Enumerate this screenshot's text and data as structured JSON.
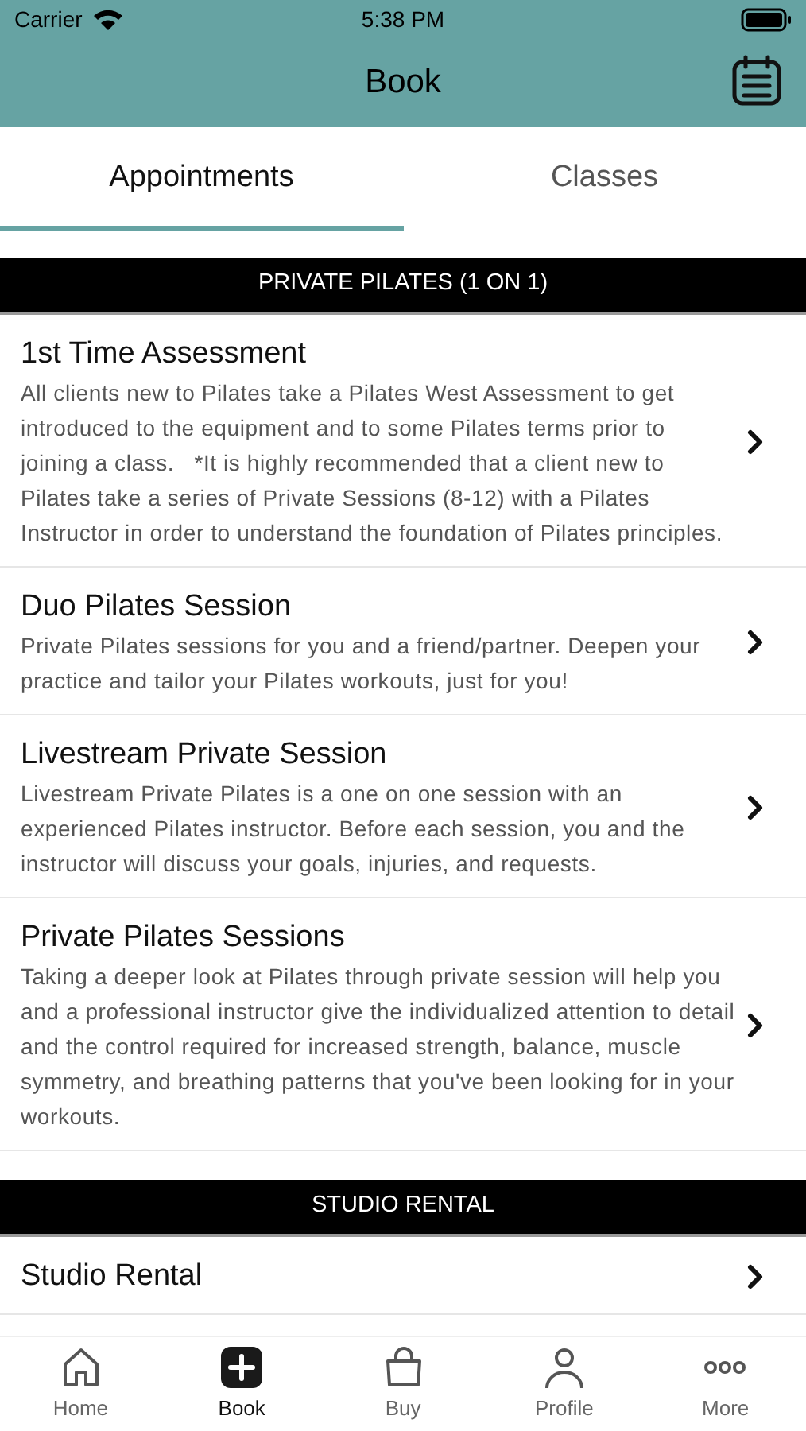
{
  "status_bar": {
    "carrier": "Carrier",
    "time": "5:38 PM"
  },
  "nav_bar": {
    "title": "Book"
  },
  "tabs": [
    {
      "label": "Appointments",
      "selected": true
    },
    {
      "label": "Classes",
      "selected": false
    }
  ],
  "sections": [
    {
      "title": "PRIVATE PILATES (1 ON 1)",
      "items": [
        {
          "title": "1st Time Assessment",
          "description": "All clients new to Pilates take a Pilates West Assessment to get introduced to the equipment and to some Pilates terms prior to joining a class.   *It is highly recommended that a client new to Pilates take a series of Private Sessions (8-12) with a Pilates Instructor in order to understand the foundation of Pilates principles."
        },
        {
          "title": "Duo Pilates Session",
          "description": "Private Pilates sessions for you and a friend/partner. Deepen your practice and tailor your Pilates workouts, just for you!"
        },
        {
          "title": "Livestream Private Session",
          "description": "Livestream Private Pilates is a one on one session with an experienced Pilates instructor. Before each session, you and the instructor will discuss your goals, injuries, and requests."
        },
        {
          "title": "Private Pilates Sessions",
          "description": "Taking a deeper look at Pilates through private session will help you and a professional instructor give the individualized attention to detail and the control required for increased strength, balance, muscle symmetry, and breathing patterns that you've been looking for in your workouts."
        }
      ]
    },
    {
      "title": "STUDIO RENTAL",
      "items": [
        {
          "title": "Studio Rental"
        }
      ]
    }
  ],
  "tab_bar": [
    {
      "label": "Home",
      "kind": "home",
      "selected": false
    },
    {
      "label": "Book",
      "kind": "book",
      "selected": true
    },
    {
      "label": "Buy",
      "kind": "buy",
      "selected": false
    },
    {
      "label": "Profile",
      "kind": "profile",
      "selected": false
    },
    {
      "label": "More",
      "kind": "more",
      "selected": false
    }
  ]
}
